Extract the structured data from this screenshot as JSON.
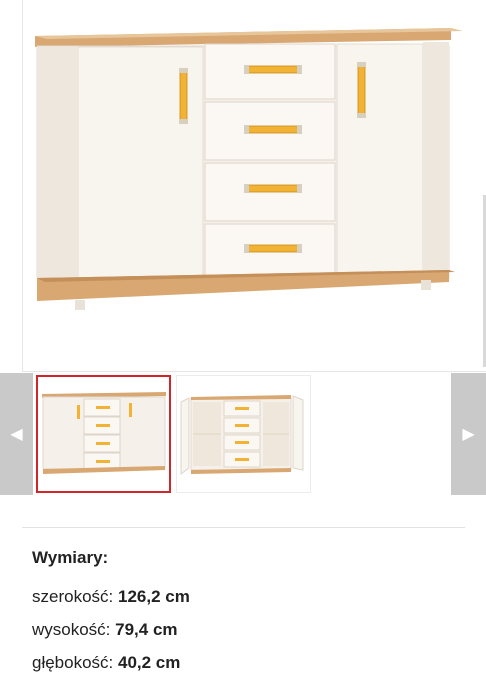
{
  "gallery": {
    "main_image_alt": "",
    "thumbnails": [
      {
        "name": "thumb-closed",
        "selected": true
      },
      {
        "name": "thumb-open",
        "selected": false
      }
    ],
    "prev_icon": "chevron-left-icon",
    "next_icon": "chevron-right-icon",
    "prev_glyph": "◀",
    "next_glyph": "▶"
  },
  "specs": {
    "title": "Wymiary:",
    "rows": [
      {
        "label": "szerokość: ",
        "value": "126,2 cm"
      },
      {
        "label": "wysokość: ",
        "value": "79,4 cm"
      },
      {
        "label": "głębokość: ",
        "value": "40,2 cm"
      }
    ]
  },
  "colors": {
    "selected_border": "#d0262a",
    "arrow_bg": "#c9c9c9",
    "body_white": "#f4efe8",
    "oak": "#d6a56f",
    "handle": "#f2b233"
  }
}
